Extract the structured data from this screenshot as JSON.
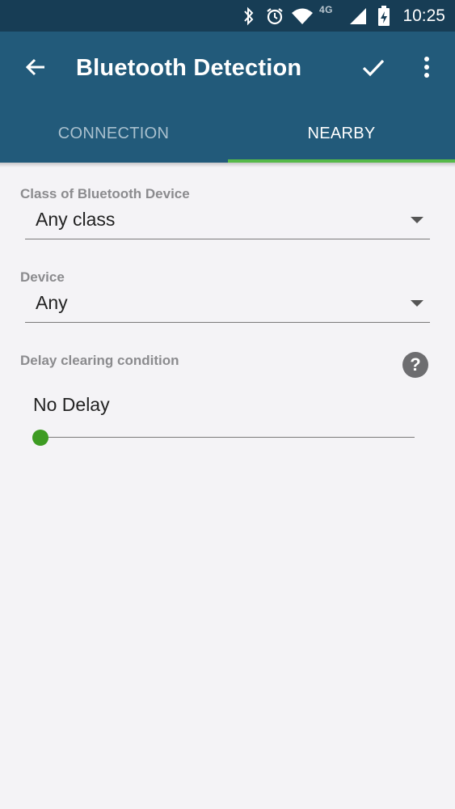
{
  "status_bar": {
    "time": "10:25",
    "network": "4G",
    "icons": [
      "bluetooth-icon",
      "alarm-icon",
      "wifi-icon",
      "signal-icon",
      "battery-charging-icon"
    ]
  },
  "app_bar": {
    "title": "Bluetooth Detection",
    "icons": [
      "back-arrow-icon",
      "check-icon",
      "more-vert-icon"
    ]
  },
  "tabs": [
    {
      "label": "CONNECTION",
      "selected": false
    },
    {
      "label": "NEARBY",
      "selected": true
    }
  ],
  "form": {
    "device_class": {
      "label": "Class of Bluetooth Device",
      "value": "Any class"
    },
    "device": {
      "label": "Device",
      "value": "Any"
    },
    "delay": {
      "label": "Delay clearing condition",
      "value": "No Delay",
      "slider_position": 0
    }
  },
  "colors": {
    "status_bar": "#173d55",
    "app_bar": "#225a7a",
    "tab_indicator": "#56b949",
    "slider_thumb": "#3d9b22",
    "background": "#f4f3f6"
  }
}
